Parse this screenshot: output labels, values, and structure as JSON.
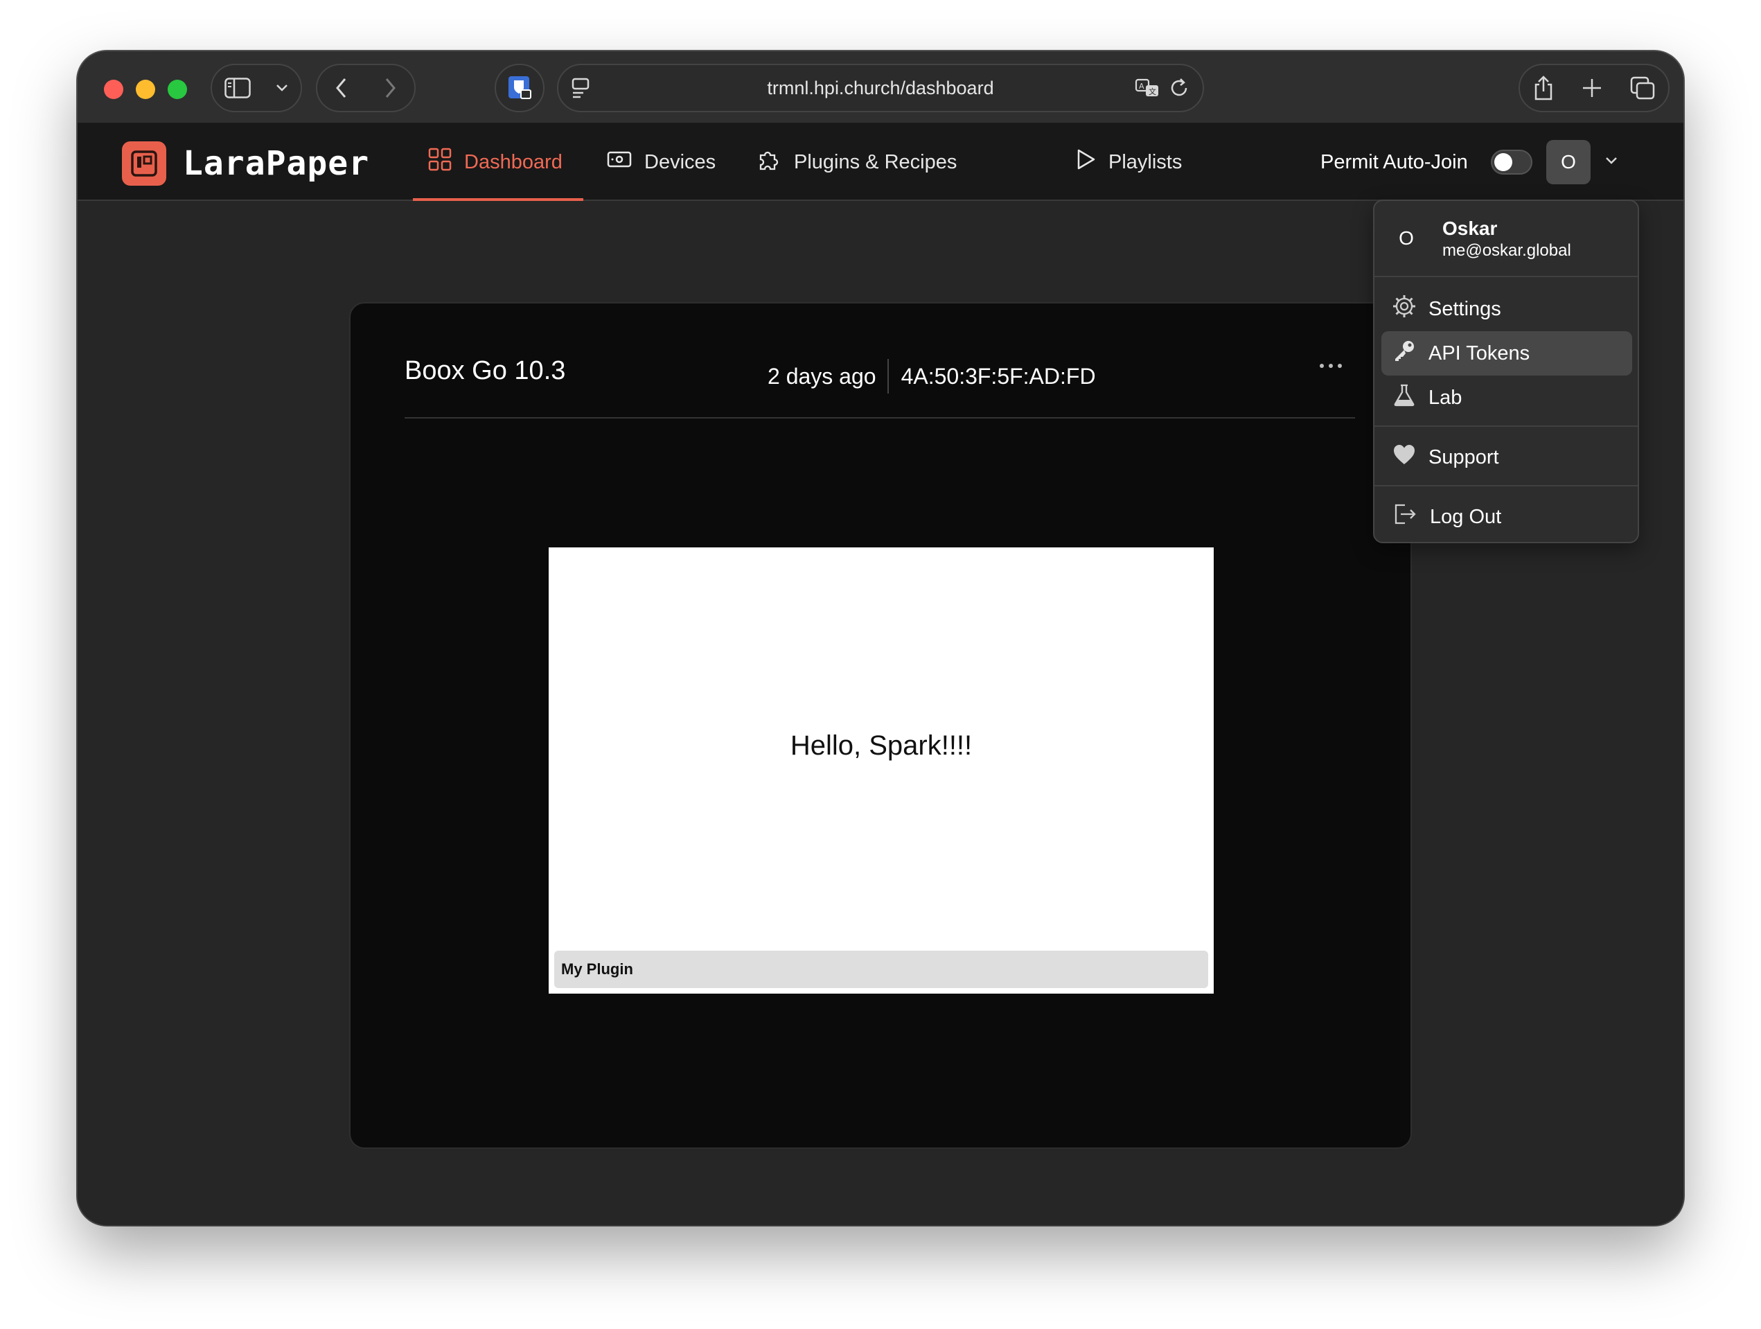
{
  "browser": {
    "url": "trmnl.hpi.church/dashboard"
  },
  "app": {
    "logo_text": "LaraPaper",
    "brand_color": "#e8604c",
    "nav": [
      {
        "label": "Dashboard",
        "icon": "grid-icon",
        "active": true
      },
      {
        "label": "Devices",
        "icon": "device-icon",
        "active": false
      },
      {
        "label": "Plugins & Recipes",
        "icon": "puzzle-icon",
        "active": false
      },
      {
        "label": "Playlists",
        "icon": "play-icon",
        "active": false
      }
    ],
    "auto_join_label": "Permit Auto-Join",
    "auto_join_enabled": false,
    "avatar_initial": "O"
  },
  "device": {
    "name": "Boox Go 10.3",
    "last_seen": "2 days ago",
    "mac": "4A:50:3F:5F:AD:FD",
    "screen_text": "Hello, Spark!!!!",
    "plugin_name": "My Plugin"
  },
  "user_menu": {
    "initial": "O",
    "name": "Oskar",
    "email": "me@oskar.global",
    "items": [
      {
        "label": "Settings",
        "icon": "gear-icon"
      },
      {
        "label": "API Tokens",
        "icon": "key-icon",
        "highlighted": true
      },
      {
        "label": "Lab",
        "icon": "flask-icon"
      },
      {
        "label": "Support",
        "icon": "heart-icon"
      },
      {
        "label": "Log Out",
        "icon": "logout-icon"
      }
    ]
  }
}
